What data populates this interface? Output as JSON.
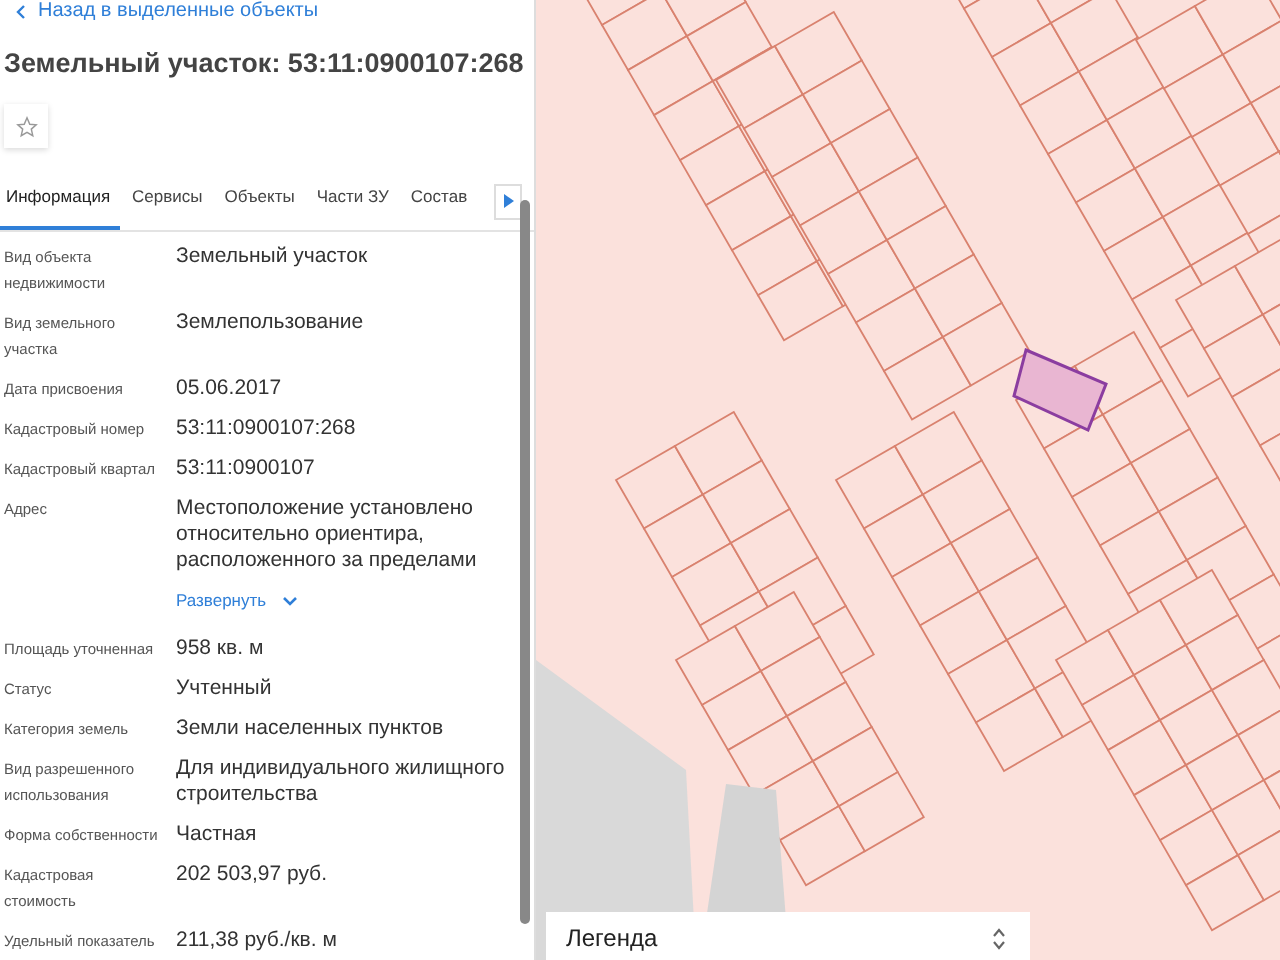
{
  "back_link": "Назад в выделенные объекты",
  "title": "Земельный участок: 53:11:0900107:268",
  "tabs": [
    {
      "label": "Информация",
      "selected": true
    },
    {
      "label": "Сервисы",
      "selected": false
    },
    {
      "label": "Объекты",
      "selected": false
    },
    {
      "label": "Части ЗУ",
      "selected": false
    },
    {
      "label": "Состав",
      "selected": false
    }
  ],
  "properties": [
    {
      "label": "Вид объекта недвижимости",
      "value": "Земельный участок"
    },
    {
      "label": "Вид земельного участка",
      "value": "Землепользование"
    },
    {
      "label": "Дата присвоения",
      "value": "05.06.2017"
    },
    {
      "label": "Кадастровый номер",
      "value": "53:11:0900107:268"
    },
    {
      "label": "Кадастровый квартал",
      "value": "53:11:0900107"
    },
    {
      "label": "Адрес",
      "value": "Местоположение установлено относительно ориентира, расположенного за пределами",
      "expand_link": "Развернуть"
    },
    {
      "label": "Площадь уточненная",
      "value": "958 кв. м"
    },
    {
      "label": "Статус",
      "value": "Учтенный"
    },
    {
      "label": "Категория земель",
      "value": "Земли населенных пунктов"
    },
    {
      "label": "Вид разрешенного использования",
      "value": "Для индивидуального жилищного строительства"
    },
    {
      "label": "Форма собственности",
      "value": "Частная"
    },
    {
      "label": "Кадастровая стоимость",
      "value": "202 503,97 руб."
    },
    {
      "label": "Удельный показатель",
      "value": "211,38 руб./кв. м"
    }
  ],
  "legend": {
    "label": "Легенда"
  }
}
